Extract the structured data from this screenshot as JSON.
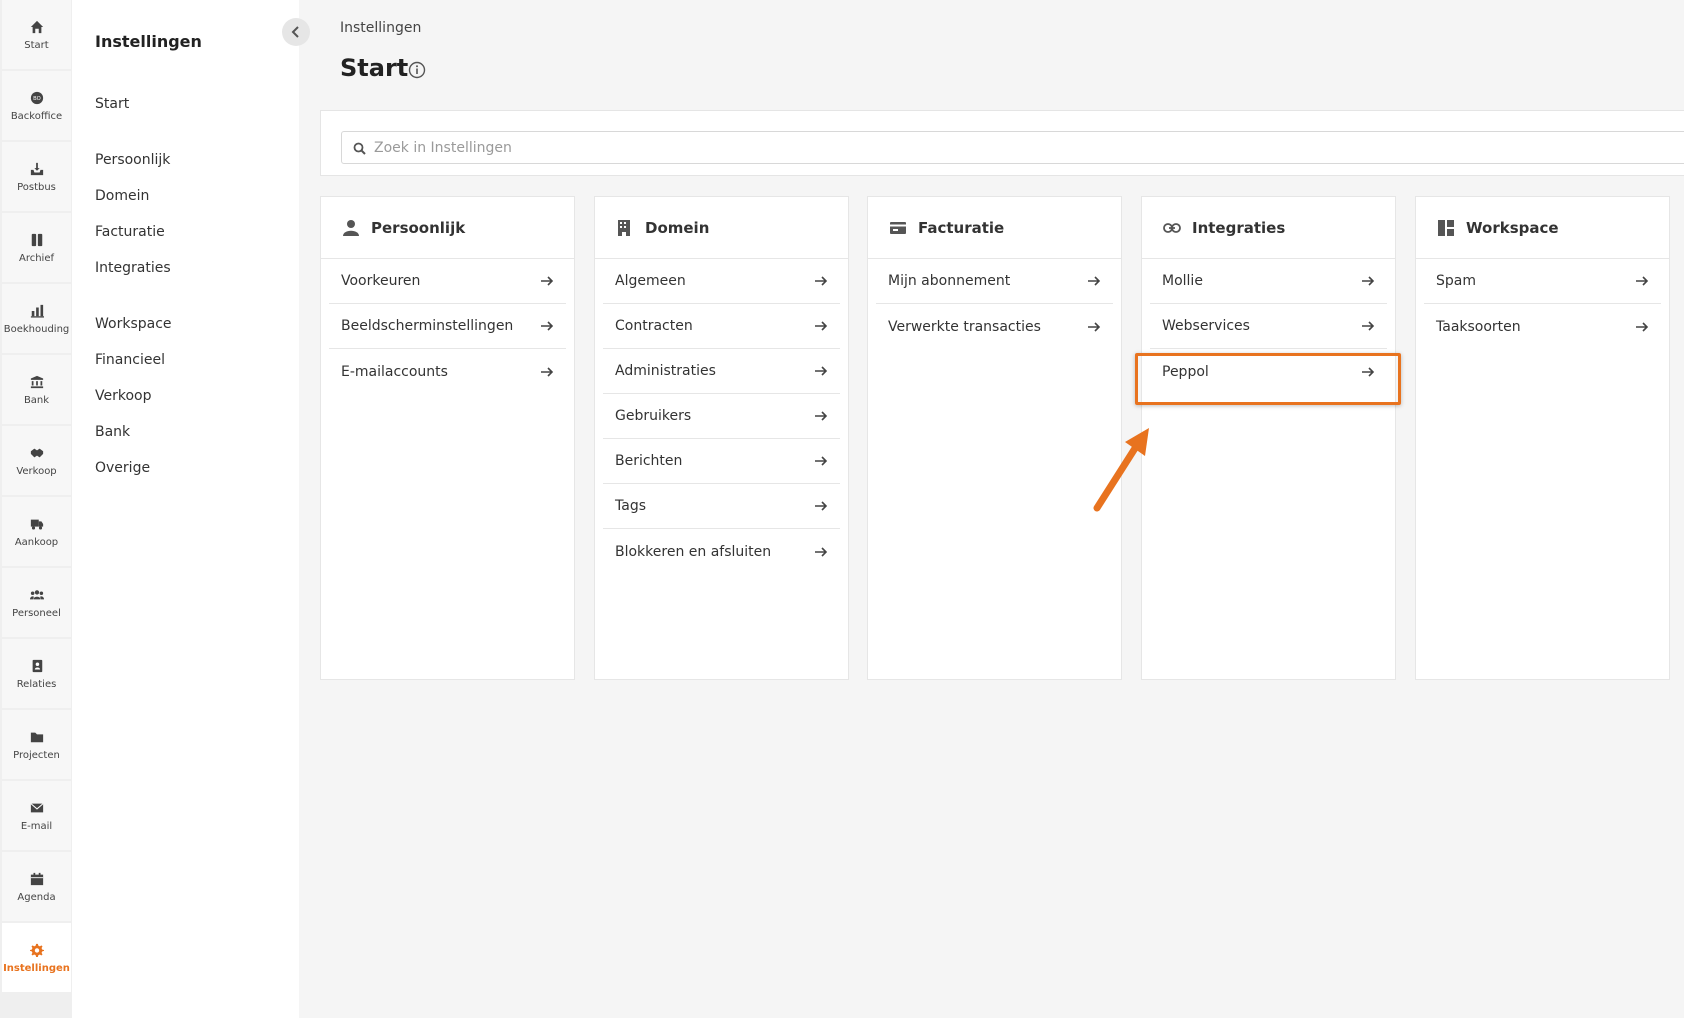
{
  "rail": {
    "items": [
      {
        "label": "Start",
        "icon": "home-icon"
      },
      {
        "label": "Backoffice",
        "icon": "backoffice-icon"
      },
      {
        "label": "Postbus",
        "icon": "inbox-icon"
      },
      {
        "label": "Archief",
        "icon": "archive-icon"
      },
      {
        "label": "Boekhouding",
        "icon": "bar-chart-icon"
      },
      {
        "label": "Bank",
        "icon": "bank-icon"
      },
      {
        "label": "Verkoop",
        "icon": "handshake-icon"
      },
      {
        "label": "Aankoop",
        "icon": "truck-icon"
      },
      {
        "label": "Personeel",
        "icon": "people-icon"
      },
      {
        "label": "Relaties",
        "icon": "address-book-icon"
      },
      {
        "label": "Projecten",
        "icon": "folder-icon"
      },
      {
        "label": "E-mail",
        "icon": "envelope-icon"
      },
      {
        "label": "Agenda",
        "icon": "calendar-icon"
      },
      {
        "label": "Instellingen",
        "icon": "gear-icon",
        "active": true
      }
    ]
  },
  "subnav": {
    "title": "Instellingen",
    "links": [
      "Start",
      "Persoonlijk",
      "Domein",
      "Facturatie",
      "Integraties",
      "Workspace",
      "Financieel",
      "Verkoop",
      "Bank",
      "Overige"
    ]
  },
  "header": {
    "breadcrumb": "Instellingen",
    "title": "Start"
  },
  "search": {
    "placeholder": "Zoek in Instellingen"
  },
  "cards": [
    {
      "title": "Persoonlijk",
      "icon": "user-icon",
      "rows": [
        "Voorkeuren",
        "Beeldscherminstellingen",
        "E-mailaccounts"
      ]
    },
    {
      "title": "Domein",
      "icon": "building-icon",
      "rows": [
        "Algemeen",
        "Contracten",
        "Administraties",
        "Gebruikers",
        "Berichten",
        "Tags",
        "Blokkeren en afsluiten"
      ]
    },
    {
      "title": "Facturatie",
      "icon": "billing-icon",
      "rows": [
        "Mijn abonnement",
        "Verwerkte transacties"
      ]
    },
    {
      "title": "Integraties",
      "icon": "link-icon",
      "rows": [
        "Mollie",
        "Webservices",
        "Peppol"
      ]
    },
    {
      "title": "Workspace",
      "icon": "workspace-icon",
      "rows": [
        "Spam",
        "Taaksoorten"
      ]
    }
  ],
  "colors": {
    "accent": "#e8731f",
    "highlight": "#e8731f"
  }
}
